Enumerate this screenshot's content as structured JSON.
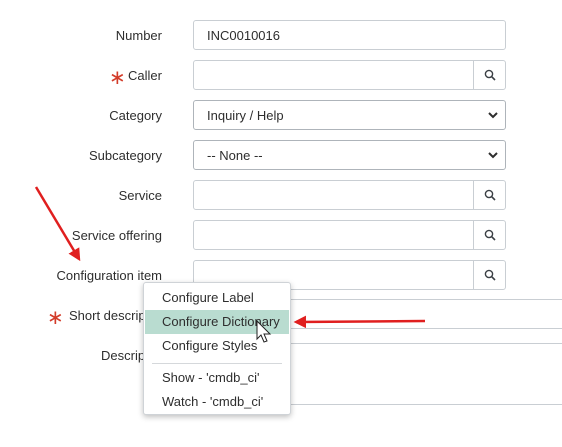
{
  "form": {
    "number": {
      "label": "Number",
      "value": "INC0010016"
    },
    "caller": {
      "label": "Caller",
      "value": "",
      "required_marker": "∗"
    },
    "category": {
      "label": "Category",
      "value": "Inquiry / Help"
    },
    "subcategory": {
      "label": "Subcategory",
      "value": "-- None --"
    },
    "service": {
      "label": "Service",
      "value": ""
    },
    "service_offering": {
      "label": "Service offering",
      "value": ""
    },
    "configuration_item": {
      "label": "Configuration item",
      "value": ""
    },
    "short_description": {
      "label": "Short descrip",
      "value": "",
      "required_marker": "∗"
    },
    "description": {
      "label": "Descrip",
      "value": ""
    }
  },
  "context_menu": {
    "items": [
      {
        "label": "Configure Label"
      },
      {
        "label": "Configure Dictionary"
      },
      {
        "label": "Configure Styles"
      },
      {
        "label": "Show - 'cmdb_ci'"
      },
      {
        "label": "Watch - 'cmdb_ci'"
      }
    ],
    "highlighted_index": 1
  },
  "icons": {
    "lookup": "magnifier-icon",
    "select": "chevron-down-icon",
    "required": "asterisk-icon",
    "cursor": "mouse-pointer-icon",
    "annotation": "red-arrow-icon"
  },
  "colors": {
    "required_marker": "#d33c2a",
    "menu_highlight": "#b9dcd0",
    "annotation_arrow": "#e01f1f",
    "field_border": "#c9ced3"
  }
}
